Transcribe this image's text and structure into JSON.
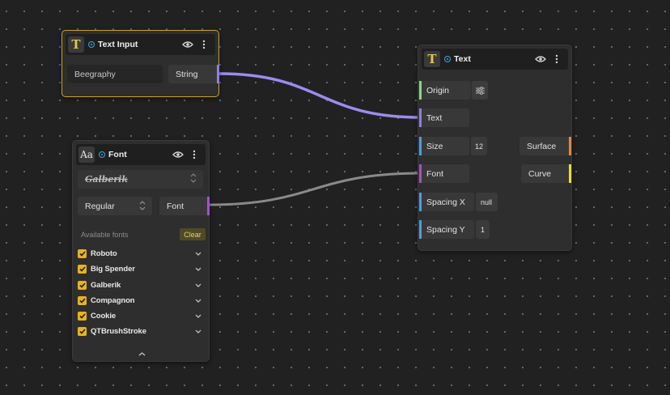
{
  "colors": {
    "background": "#212121",
    "selected_border": "#c9a227",
    "wire_string": "#9b8cf0",
    "wire_font": "#8a8a8a",
    "port_string": "#8e7fe6",
    "port_font": "#a24fd8",
    "port_origin": "#8fd48a",
    "port_size": "#3fa7d6",
    "port_surface": "#e08a3a",
    "port_curve": "#e8e020",
    "checkbox": "#e8b21e"
  },
  "text_input_node": {
    "title": "Text Input",
    "icon": "text-icon",
    "value": "Beegraphy",
    "output_label": "String"
  },
  "font_node": {
    "title": "Font",
    "icon": "font-icon",
    "selected_font_preview": "Galberik",
    "style_value": "Regular",
    "output_label": "Font",
    "available_fonts_label": "Available fonts",
    "clear_label": "Clear",
    "fonts": [
      {
        "label": "Roboto",
        "checked": true
      },
      {
        "label": "Big Spender",
        "checked": true
      },
      {
        "label": "Galberik",
        "checked": true
      },
      {
        "label": "Compagnon",
        "checked": true
      },
      {
        "label": "Cookie",
        "checked": true
      },
      {
        "label": "QTBrushStroke",
        "checked": true
      }
    ]
  },
  "text_node": {
    "title": "Text",
    "icon": "text-icon",
    "inputs": {
      "origin": "Origin",
      "text": "Text",
      "size": "Size",
      "size_value": "12",
      "font": "Font",
      "spacing_x": "Spacing X",
      "spacing_x_value": "null",
      "spacing_y": "Spacing Y",
      "spacing_y_value": "1"
    },
    "outputs": {
      "surface": "Surface",
      "curve": "Curve"
    }
  }
}
